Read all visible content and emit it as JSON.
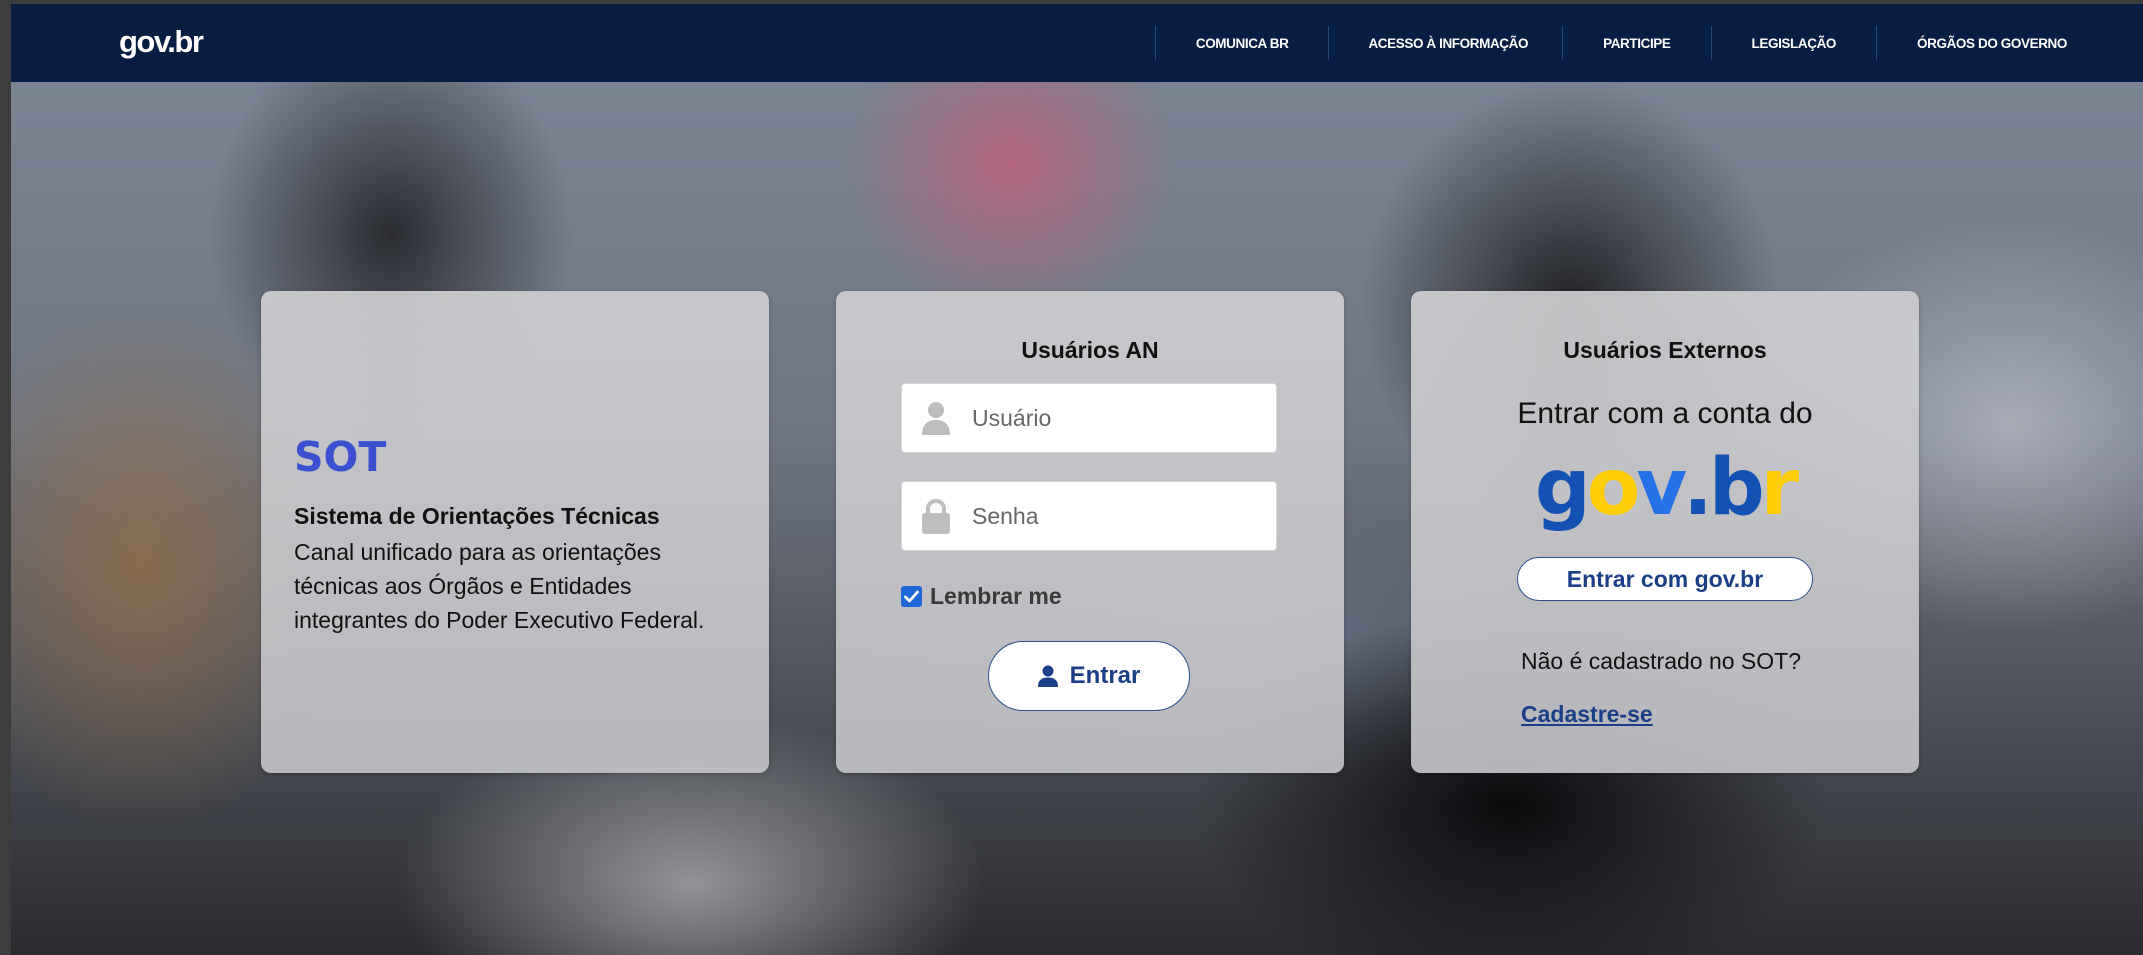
{
  "header": {
    "logo": "gov.br",
    "nav": [
      {
        "label": "COMUNICA BR"
      },
      {
        "label": "ACESSO À INFORMAÇÃO"
      },
      {
        "label": "PARTICIPE"
      },
      {
        "label": "LEGISLAÇÃO"
      },
      {
        "label": "ÓRGÃOS DO GOVERNO"
      }
    ]
  },
  "intro": {
    "title": "SOT",
    "subtitle": "Sistema de Orientações Técnicas",
    "description": "Canal unificado para as orientações técnicas aos Órgãos e Entidades integrantes do Poder Executivo Federal."
  },
  "login_an": {
    "heading": "Usuários AN",
    "username_placeholder": "Usuário",
    "username_value": "",
    "password_placeholder": "Senha",
    "password_value": "",
    "remember_label": "Lembrar me",
    "remember_checked": true,
    "submit_label": "Entrar"
  },
  "external": {
    "heading": "Usuários Externos",
    "line": "Entrar com a conta do",
    "logo_letters": [
      "g",
      "o",
      "v",
      ".",
      "b",
      "r"
    ],
    "button_label": "Entrar com gov.br",
    "not_registered": "Não é cadastrado no SOT?",
    "register_link": "Cadastre-se"
  },
  "colors": {
    "header_bg": "#071d41",
    "accent_blue": "#1a3f87",
    "sot_title": "#3b4fd0",
    "logo_g": "#1351b4",
    "logo_o": "#ffcd07",
    "logo_v": "#2670e8",
    "logo_dot": "#1351b4",
    "logo_b": "#1351b4",
    "logo_r": "#ffcd07"
  },
  "icons": {
    "username": "user-icon",
    "password": "lock-icon",
    "submit": "user-icon",
    "checkbox": "check-icon"
  }
}
